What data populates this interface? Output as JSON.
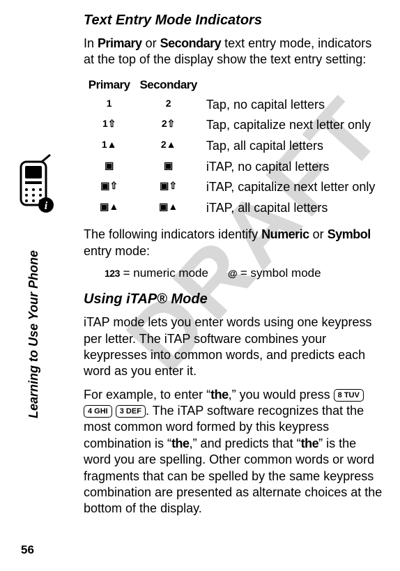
{
  "watermark": "DRAFT",
  "sidebar": {
    "vertical_text": "Learning to Use Your Phone",
    "page_number": "56"
  },
  "section1": {
    "heading": "Text Entry Mode Indicators",
    "intro_pre": "In ",
    "intro_b1": "Primary",
    "intro_mid": " or ",
    "intro_b2": "Secondary",
    "intro_post": " text entry mode, indicators at the top of the display show the text entry setting:"
  },
  "table": {
    "head_primary": "Primary",
    "head_secondary": "Secondary",
    "rows": [
      {
        "p": "1",
        "s": "2",
        "desc": "Tap, no capital letters"
      },
      {
        "p": "1⇧",
        "s": "2⇧",
        "desc": "Tap, capitalize next letter only"
      },
      {
        "p": "1▲",
        "s": "2▲",
        "desc": "Tap, all capital letters"
      },
      {
        "p": "▣",
        "s": "▣",
        "desc": "iTAP, no capital letters"
      },
      {
        "p": "▣⇧",
        "s": "▣⇧",
        "desc": "iTAP, capitalize next letter only"
      },
      {
        "p": "▣▲",
        "s": "▣▲",
        "desc": "iTAP, all capital letters"
      }
    ]
  },
  "after_table": {
    "pre": "The following indicators identify ",
    "b1": "Numeric",
    "mid": " or ",
    "b2": "Symbol",
    "post": " entry mode:"
  },
  "legend": {
    "num_sym": "123",
    "num_desc": " = numeric mode",
    "sym_sym": "@",
    "sym_desc": " = symbol mode"
  },
  "section2": {
    "heading": "Using iTAP® Mode",
    "p1": "iTAP mode lets you enter words using one keypress per letter. The iTAP software combines your keypresses into common words, and predicts each word as you enter it.",
    "p2_pre": "For example, to enter “",
    "p2_b1": "the",
    "p2_mid1": ",” you would press ",
    "key1": "8 TUV",
    "key2": "4 GHI",
    "key3": "3 DEF",
    "p2_mid2": ". The iTAP software recognizes that the most common word formed by this keypress combination is “",
    "p2_b2": "the",
    "p2_mid3": ",” and predicts that “",
    "p2_b3": "the",
    "p2_post": "” is the word you are spelling. Other common words or word fragments that can be spelled by the same keypress combination are presented as alternate choices at the bottom of the display."
  }
}
